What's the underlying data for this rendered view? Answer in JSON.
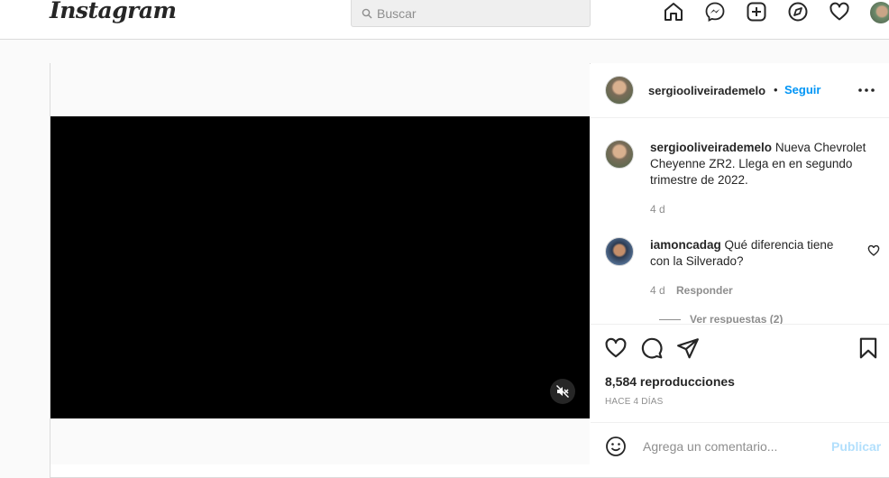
{
  "nav": {
    "logo": "Instagram",
    "search_placeholder": "Buscar",
    "icons": [
      "home-icon",
      "messenger-icon",
      "new-post-icon",
      "explore-icon",
      "activity-heart-icon",
      "profile-avatar"
    ]
  },
  "post": {
    "author": "sergiooliveirademelo",
    "separator": "•",
    "follow_label": "Seguir",
    "caption": {
      "user": "sergiooliveirademelo",
      "text": "Nueva Chevrolet Cheyenne ZR2. Llega en en segundo trimestre de 2022.",
      "age": "4 d"
    },
    "comments": [
      {
        "user": "iamoncadag",
        "text": "Qué diferencia tiene con la Silverado?",
        "age": "4 d",
        "reply_label": "Responder"
      }
    ],
    "view_replies": "Ver respuestas (2)",
    "views": "8,584 reproducciones",
    "time": "HACE 4 DÍAS",
    "comment_placeholder": "Agrega un comentario...",
    "publish_label": "Publicar"
  },
  "colors": {
    "link_blue": "#0095f6",
    "publish_disabled": "#b2dffc",
    "border": "#dbdbdb",
    "muted_text": "#8e8e8e"
  }
}
